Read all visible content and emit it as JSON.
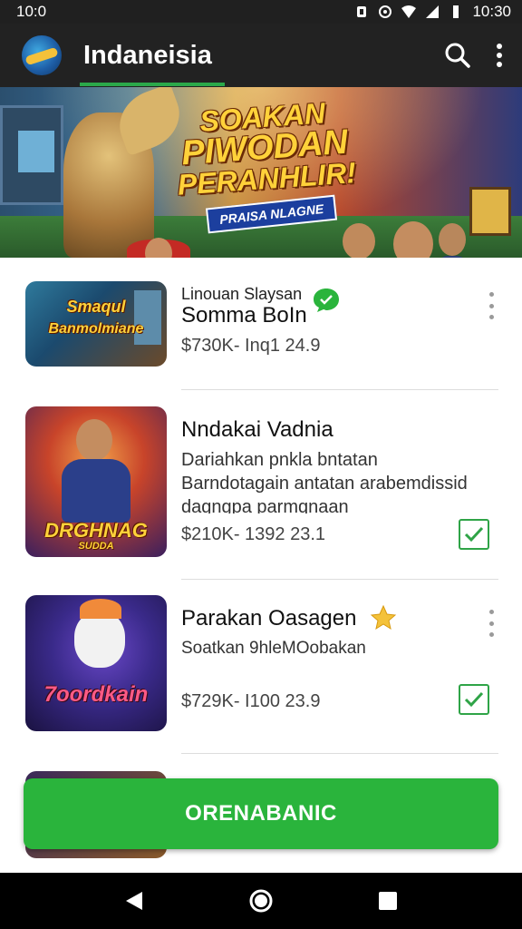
{
  "status_bar": {
    "time_left": "10:0",
    "time_right": "10:30"
  },
  "app_bar": {
    "title": "Indaneisia"
  },
  "hero": {
    "title_lines": [
      "SOAKAN",
      "PIWODAN",
      "PERANHLIR!"
    ],
    "subtitle": "PRAISA NLAGNE"
  },
  "items": [
    {
      "overline": "Linouan Slaysan",
      "title": "Somma BoIn",
      "meta": "$730K-  Inq1   24.9",
      "thumb_label": "Banmolmiane",
      "thumb_label_top": "Smaqul"
    },
    {
      "title": "Nndakai Vadnia",
      "description": "Dariahkan pnkla bntatan Barndotagain antatan arabemdissid dagngpa parmqnaan",
      "meta": "$210K-  1392   23.1",
      "thumb_label": "DRGHNAG",
      "thumb_label_sub": "SUDDA"
    },
    {
      "title": "Parakan Oasagen",
      "subtitle": "Soatkan 9hleMOobakan",
      "meta": "$729K-  I100   23.9",
      "thumb_label": "7oordkain"
    }
  ],
  "cta": {
    "label": "ORENABANIC"
  },
  "colors": {
    "accent": "#2ab43c",
    "app_bar": "#222222",
    "check": "#2fa447"
  }
}
